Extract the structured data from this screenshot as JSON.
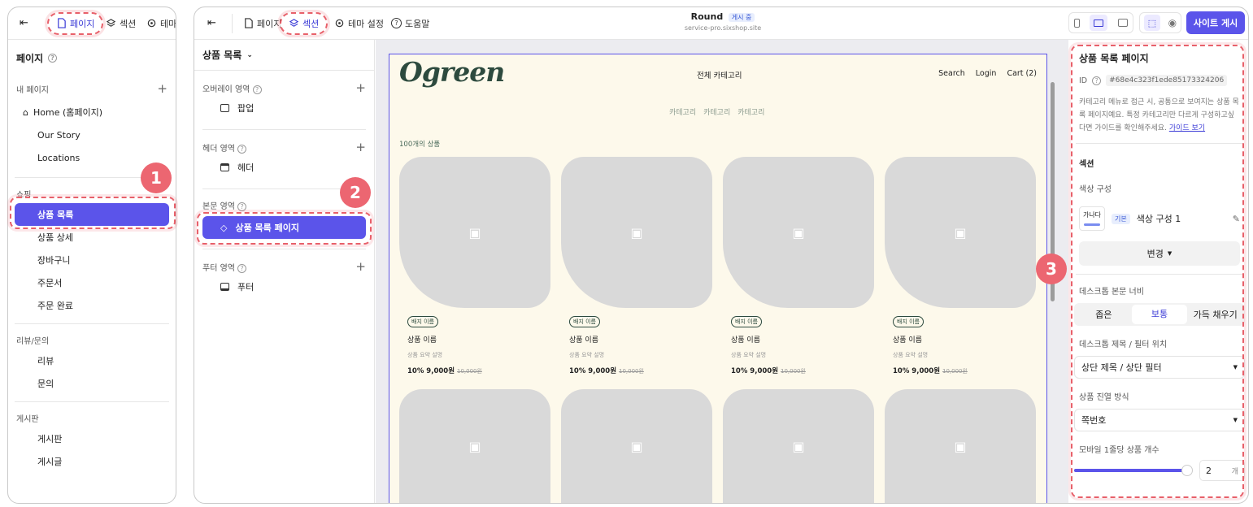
{
  "w1": {
    "tabs": [
      "페이지",
      "섹션",
      "테마"
    ],
    "title": "페이지",
    "groups": {
      "my": "내 페이지",
      "shop": "쇼핑",
      "review": "리뷰/문의",
      "board": "게시판"
    },
    "my_pages": [
      "Home (홈페이지)",
      "Our Story",
      "Locations"
    ],
    "shop_pages": [
      "상품 목록",
      "상품 상세",
      "장바구니",
      "주문서",
      "주문 완료"
    ],
    "review_pages": [
      "리뷰",
      "문의"
    ],
    "board_pages": [
      "게시판",
      "게시글"
    ]
  },
  "w2": {
    "tabs": [
      "페이지",
      "섹션",
      "테마 설정",
      "도움말"
    ],
    "site_name": "Round",
    "status": "게시 중",
    "url": "service-pro.sixshop.site",
    "publish": "사이트 게시",
    "page_select": "상품 목록",
    "areas": [
      {
        "label": "오버레이 영역",
        "item": "팝업"
      },
      {
        "label": "헤더 영역",
        "item": "헤더"
      },
      {
        "label": "본문 영역",
        "item": "상품 목록 페이지"
      },
      {
        "label": "푸터 영역",
        "item": "푸터"
      }
    ],
    "canvas": {
      "logo": "Ogreen",
      "nav_center": "전체 카테고리",
      "nav_right": [
        "Search",
        "Login",
        "Cart (2)"
      ],
      "cats": [
        "카테고리",
        "카테고리",
        "카테고리"
      ],
      "count": "100개의 상품",
      "products": [
        {
          "badge": "배지 이름",
          "name": "상품 이름",
          "desc": "상품 요약 설명",
          "price": "10% 9,000원",
          "orig": "10,000원"
        },
        {
          "badge": "배지 이름",
          "name": "상품 이름",
          "desc": "상품 요약 설명",
          "price": "10% 9,000원",
          "orig": "10,000원"
        },
        {
          "badge": "배지 이름",
          "name": "상품 이름",
          "desc": "상품 요약 설명",
          "price": "10% 9,000원",
          "orig": "10,000원"
        },
        {
          "badge": "배지 이름",
          "name": "상품 이름",
          "desc": "상품 요약 설명",
          "price": "10% 9,000원",
          "orig": "10,000원"
        }
      ]
    },
    "panel": {
      "title": "상품 목록 페이지",
      "id_label": "ID",
      "id_value": "#68e4c323f1ede85173324206",
      "desc": "카테고리 메뉴로 접근 시, 공통으로 보여지는 상품 목록 페이지예요. 특정 카테고리만 다르게 구성하고싶다면 가이드를 확인해주세요.",
      "guide": "가이드 보기",
      "section": "섹션",
      "color_label": "색상 구성",
      "swatch": "가나다",
      "basic": "기본",
      "color_name": "색상 구성 1",
      "change": "변경",
      "width_label": "데스크톱 본문 너비",
      "widths": [
        "좁은",
        "보통",
        "가득 채우기"
      ],
      "title_pos_label": "데스크톱 제목 / 필터 위치",
      "title_pos": "상단 제목 / 상단 필터",
      "order_label": "상품 진열 방식",
      "order": "쪽번호",
      "mobile_label": "모바일 1줄당 상품 개수",
      "mobile_value": "2",
      "unit": "개",
      "slider_pct": 0.95
    }
  },
  "badges": [
    "1",
    "2",
    "3"
  ],
  "colors": {
    "accent": "#5b54ea",
    "highlight": "#e8606a",
    "logo": "#2d4a3e",
    "canvas_bg": "#fdf9eb"
  }
}
